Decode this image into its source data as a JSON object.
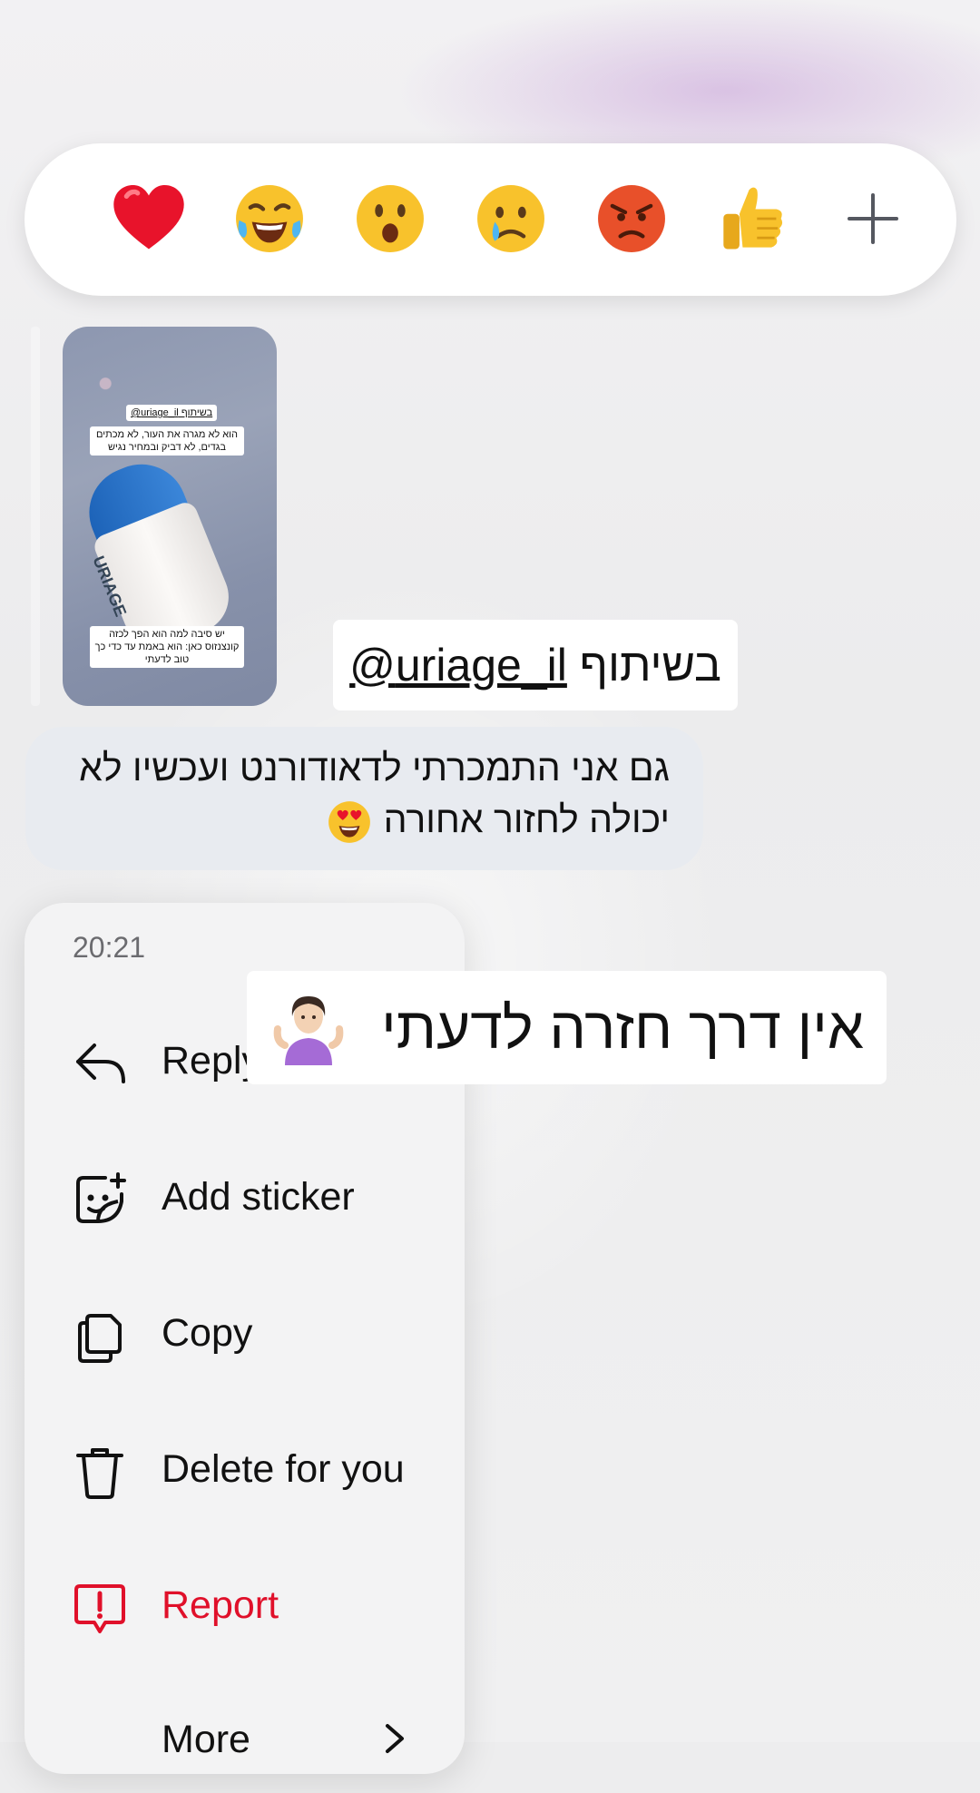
{
  "reactions": {
    "items": [
      {
        "name": "heart",
        "glyph": "❤️"
      },
      {
        "name": "laughing",
        "glyph": "😂"
      },
      {
        "name": "surprised",
        "glyph": "😮"
      },
      {
        "name": "crying",
        "glyph": "😢"
      },
      {
        "name": "angry",
        "glyph": "😡"
      },
      {
        "name": "thumbs-up",
        "glyph": "👍"
      }
    ],
    "more_icon": "plus-icon"
  },
  "story": {
    "tag_top": "בשיתוף uriage_il@",
    "caption_top": "הוא לא מגרה את העור, לא מכתים בגדים, לא דביק ובמחיר נגיש",
    "caption_bottom": "יש סיבה למה הוא הפך לכזה קונצנזוס כאן: הוא באמת עד כדי כך טוב לדעתי",
    "product_brand": "URIAGE"
  },
  "sticker_partnership": {
    "prefix": "בשיתוף",
    "mention": "uriage_il@"
  },
  "message": {
    "text": "גם אני התמכרתי לדאודורנט ועכשיו לא יכולה לחזור אחורה",
    "emoji": "heart-eyes"
  },
  "context_menu": {
    "time": "20:21",
    "items": [
      {
        "label": "Reply",
        "icon": "reply-icon"
      },
      {
        "label": "Add sticker",
        "icon": "sticker-icon"
      },
      {
        "label": "Copy",
        "icon": "copy-icon"
      },
      {
        "label": "Delete for you",
        "icon": "trash-icon"
      },
      {
        "label": "Report",
        "icon": "report-icon",
        "color": "#e0102a"
      },
      {
        "label": "More",
        "icon": "chevron-right-icon"
      }
    ]
  },
  "sticker_reply": {
    "text": "אין דרך חזרה לדעתי",
    "emoji": "person-shrugging"
  }
}
